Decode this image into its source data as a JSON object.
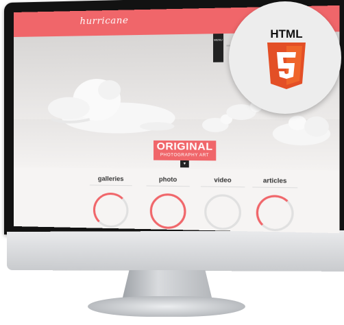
{
  "website": {
    "logo": "hurricane",
    "nav_box_label": "MENU",
    "hero": {
      "badge_title": "ORIGINAL",
      "badge_subtitle": "PHOTOGRAPHY ART",
      "arrow_icon": "chevron-down-icon"
    },
    "sections": [
      {
        "label": "galleries"
      },
      {
        "label": "photo"
      },
      {
        "label": "video"
      },
      {
        "label": "articles"
      }
    ]
  },
  "badge": {
    "text": "HTML",
    "shield_number": "5"
  },
  "colors": {
    "accent": "#f0666a",
    "html5_orange": "#e34f26",
    "html5_light": "#ef652a"
  }
}
